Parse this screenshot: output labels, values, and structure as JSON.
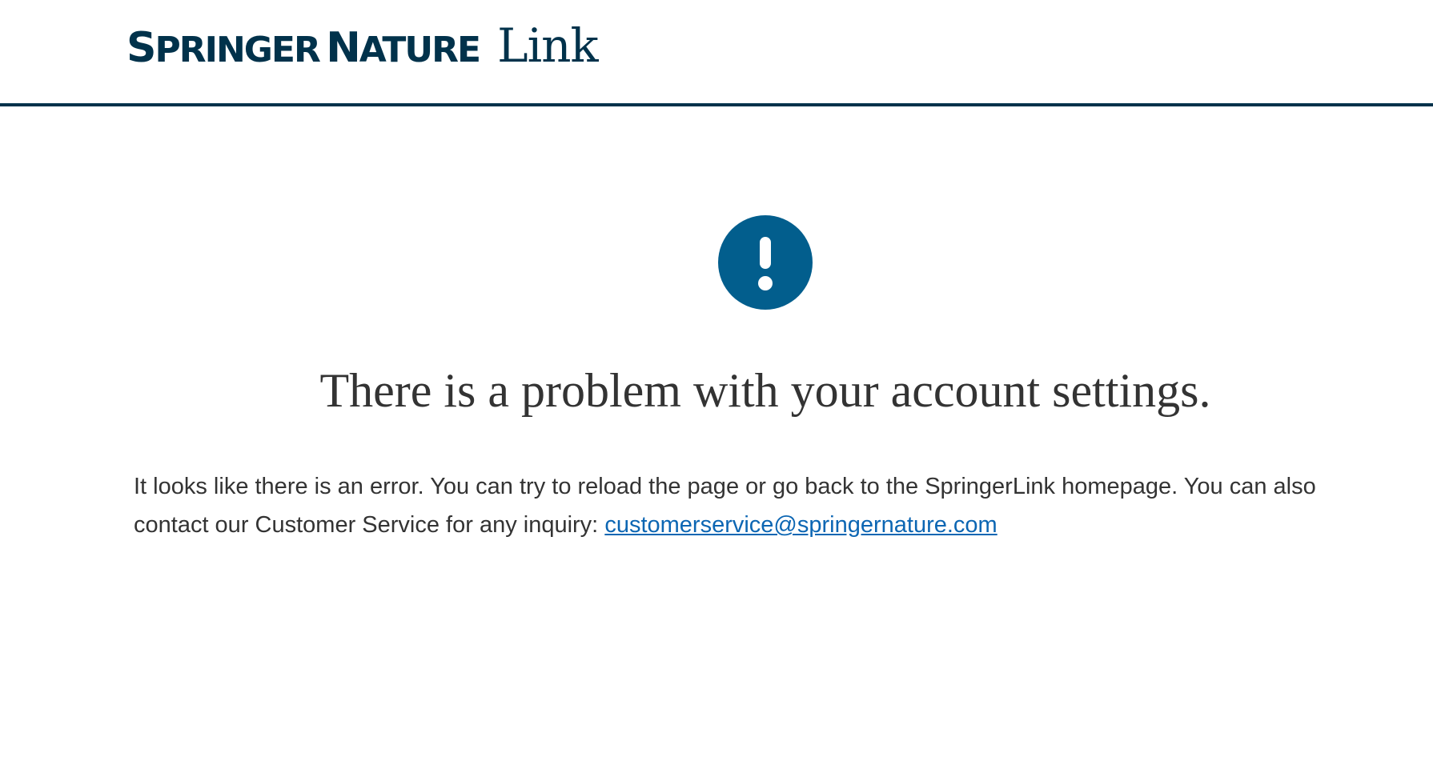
{
  "header": {
    "logo": {
      "brand": "Springer Nature",
      "product": "Link"
    }
  },
  "main": {
    "icon": "exclamation-circle-icon",
    "headline": "There is a problem with your account settings.",
    "message": {
      "text": "It looks like there is an error. You can try to reload the page or go back to the SpringerLink homepage. You can also contact our Customer Service for any inquiry: ",
      "email": "customerservice@springernature.com",
      "email_href": "mailto:customerservice@springernature.com"
    }
  },
  "colors": {
    "brand_navy": "#01324b",
    "icon_blue": "#025e8d",
    "link_blue": "#0c66b3",
    "text": "#333333"
  }
}
